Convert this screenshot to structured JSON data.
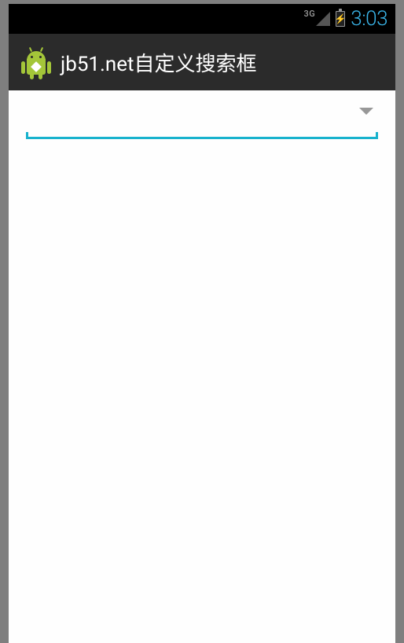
{
  "statusBar": {
    "networkLabel": "3G",
    "time": "3:03"
  },
  "actionBar": {
    "title": "jb51.net自定义搜索框"
  },
  "search": {
    "value": "",
    "placeholder": ""
  }
}
